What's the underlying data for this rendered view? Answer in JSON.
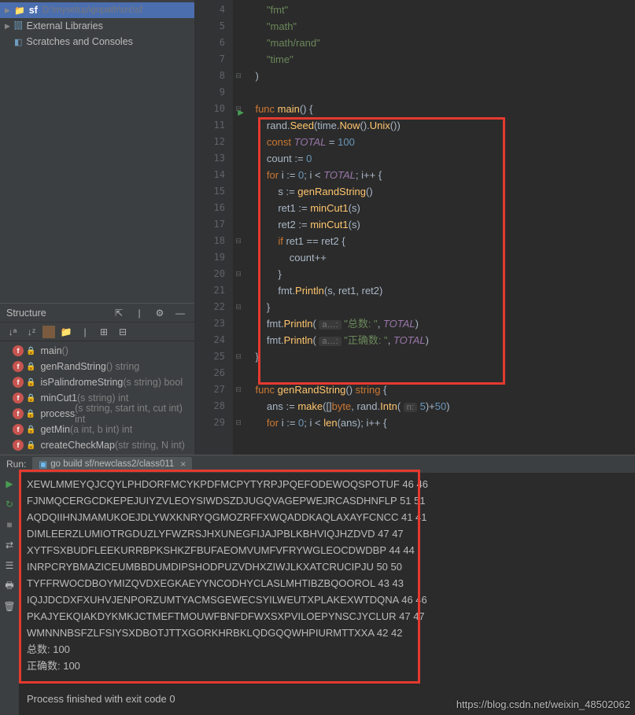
{
  "project": {
    "root_name": "sf",
    "root_path": "D:\\mysetup\\gopath\\src\\sf",
    "external_libs": "External Libraries",
    "scratches": "Scratches and Consoles"
  },
  "structure": {
    "title": "Structure",
    "items": [
      {
        "name": "main",
        "sig": "()"
      },
      {
        "name": "genRandString",
        "sig": "() string"
      },
      {
        "name": "isPalindromeString",
        "sig": "(s string) bool"
      },
      {
        "name": "minCut1",
        "sig": "(s string) int"
      },
      {
        "name": "process",
        "sig": "(s string, start int, cut int) int"
      },
      {
        "name": "getMin",
        "sig": "(a int, b int) int"
      },
      {
        "name": "createCheckMap",
        "sig": "(str string, N int)"
      }
    ]
  },
  "editor": {
    "lines": [
      {
        "n": 4,
        "fold": "",
        "html": "        <span class='str'>\"fmt\"</span>"
      },
      {
        "n": 5,
        "fold": "",
        "html": "        <span class='str'>\"math\"</span>"
      },
      {
        "n": 6,
        "fold": "",
        "html": "        <span class='str'>\"math/rand\"</span>"
      },
      {
        "n": 7,
        "fold": "",
        "html": "        <span class='str'>\"time\"</span>"
      },
      {
        "n": 8,
        "fold": "⊟",
        "html": "    )"
      },
      {
        "n": 9,
        "fold": "",
        "html": " "
      },
      {
        "n": 10,
        "fold": "⊟",
        "run": true,
        "html": "    <span class='kw'>func</span> <span class='fn'>main</span>() {"
      },
      {
        "n": 11,
        "fold": "",
        "html": "        <span class='pkg'>rand</span>.<span class='fn'>Seed</span>(<span class='pkg'>time</span>.<span class='fn'>Now</span>().<span class='fn'>Unix</span>())"
      },
      {
        "n": 12,
        "fold": "",
        "html": "        <span class='kw'>const</span> <span class='cvar'>TOTAL</span> = <span class='num'>100</span>"
      },
      {
        "n": 13,
        "fold": "",
        "html": "        <span class='id'>count</span> := <span class='num'>0</span>"
      },
      {
        "n": 14,
        "fold": "",
        "html": "        <span class='kw'>for</span> <span class='id'>i</span> := <span class='num'>0</span>; <span class='id'>i</span> &lt; <span class='cvar'>TOTAL</span>; <span class='id'>i</span>++ {"
      },
      {
        "n": 15,
        "fold": "",
        "html": "            <span class='id'>s</span> := <span class='fn'>genRandString</span>()"
      },
      {
        "n": 16,
        "fold": "",
        "html": "            <span class='id'>ret1</span> := <span class='fn'>minCut1</span>(<span class='id'>s</span>)"
      },
      {
        "n": 17,
        "fold": "",
        "html": "            <span class='id'>ret2</span> := <span class='fn'>minCut1</span>(<span class='id'>s</span>)"
      },
      {
        "n": 18,
        "fold": "⊟",
        "html": "            <span class='kw'>if</span> <span class='id'>ret1</span> == <span class='id'>ret2</span> {"
      },
      {
        "n": 19,
        "fold": "",
        "html": "                <span class='id'>count</span>++"
      },
      {
        "n": 20,
        "fold": "⊟",
        "html": "            }"
      },
      {
        "n": 21,
        "fold": "",
        "html": "            <span class='pkg'>fmt</span>.<span class='fn'>Println</span>(<span class='id'>s</span>, <span class='id'>ret1</span>, <span class='id'>ret2</span>)"
      },
      {
        "n": 22,
        "fold": "⊟",
        "html": "        }"
      },
      {
        "n": 23,
        "fold": "",
        "html": "        <span class='pkg'>fmt</span>.<span class='fn'>Println</span>( <span class='hint'>a…:</span> <span class='str'>\"总数: \"</span>, <span class='cvar'>TOTAL</span>)"
      },
      {
        "n": 24,
        "fold": "",
        "html": "        <span class='pkg'>fmt</span>.<span class='fn'>Println</span>( <span class='hint'>a…:</span> <span class='str'>\"正确数: \"</span>, <span class='cvar'>TOTAL</span>)"
      },
      {
        "n": 25,
        "fold": "⊟",
        "html": "    }"
      },
      {
        "n": 26,
        "fold": "",
        "html": " "
      },
      {
        "n": 27,
        "fold": "⊟",
        "html": "    <span class='kw'>func</span> <span class='fn'>genRandString</span>() <span class='kw'>string</span> {"
      },
      {
        "n": 28,
        "fold": "",
        "html": "        <span class='id'>ans</span> := <span class='fn'>make</span>([]<span class='kw'>byte</span>, <span class='pkg'>rand</span>.<span class='fn'>Intn</span>( <span class='hint'>n:</span> <span class='num'>5</span>)+<span class='num'>50</span>)"
      },
      {
        "n": 29,
        "fold": "⊟",
        "html": "        <span class='kw'>for</span> <span class='id'>i</span> := <span class='num'>0</span>; <span class='id'>i</span> &lt; <span class='fn'>len</span>(<span class='id'>ans</span>); <span class='id'>i</span>++ {"
      }
    ]
  },
  "run": {
    "label": "Run:",
    "tab": "go build sf/newclass2/class011",
    "lines": [
      "XEWLMMEYQJCQYLPHDORFMCYKPDFMCPYTYRPJPQEFODEWOQSPOTUF 46 46",
      "FJNMQCERGCDKEPEJUIYZVLEOYSIWDSZDJUGQVAGEPWEJRCASDHNFLP 51 51",
      "AQDQIIHNJMAMUKOEJDLYWXKNRYQGMOZRFFXWQADDKAQLAXAYFCNCC 41 41",
      "DIMLEERZLUMIOTRGDUZLYFWZRSJHXUNEGFIJAJPBLKBHVIQJHZDVD 47 47",
      "XYTFSXBUDFLEEKURRBPKSHKZFBUFAEOMVUMFVFRYWGLEOCDWDBP 44 44",
      "INRPCRYBMAZICEUMBBDUMDIPSHODPUZVDHXZIWJLKXATCRUCIPJU 50 50",
      "TYFFRWOCDBOYMIZQVDXEGKAEYYNCODHYCLASLMHTIBZBQOOROL 43 43",
      "IQJJDCDXFXUHVJENPORZUMTYACMSGEWECSYILWEUTXPLAKEXWTDQNA 46 46",
      "PKAJYEKQIAKDYKMKJCTMEFTMOUWFBNFDFWXSXPVILOEPYNSCJYCLUR 47 47",
      "WMNNNBSFZLFSIYSXDBOTJTTXGORKHRBKLQDGQQWHPIURMTTXXA 42 42",
      "总数:  100",
      "正确数:  100",
      "",
      "Process finished with exit code 0"
    ]
  },
  "watermark": "https://blog.csdn.net/weixin_48502062"
}
